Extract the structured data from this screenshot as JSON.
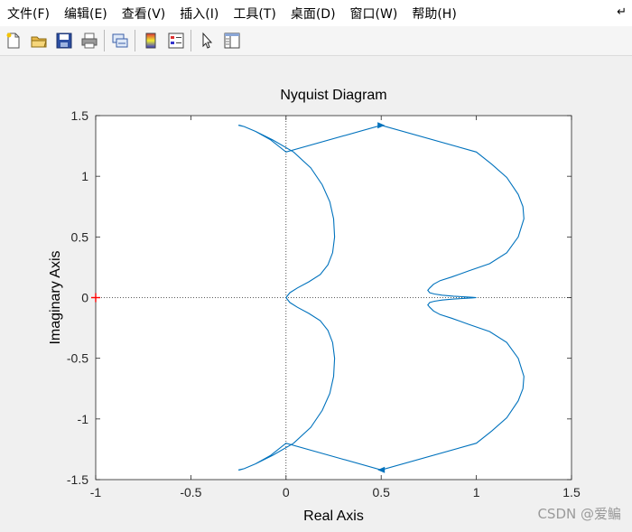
{
  "menu": {
    "items": [
      "文件(F)",
      "编辑(E)",
      "查看(V)",
      "插入(I)",
      "工具(T)",
      "桌面(D)",
      "窗口(W)",
      "帮助(H)"
    ],
    "corner_icon": "dock-arrow-icon"
  },
  "toolbar": {
    "buttons": [
      "new-figure-icon",
      "open-file-icon",
      "save-icon",
      "print-icon",
      "link-plot-icon",
      "colorbar-icon",
      "legend-icon",
      "pointer-icon",
      "plot-browser-icon"
    ]
  },
  "watermark": "CSDN @爱鳊",
  "chart_data": {
    "type": "line",
    "title": "Nyquist Diagram",
    "xlabel": "Real Axis",
    "ylabel": "Imaginary Axis",
    "xlim": [
      -1,
      1.5
    ],
    "ylim": [
      -1.5,
      1.5
    ],
    "xticks": [
      "-1",
      "-0.5",
      "0",
      "0.5",
      "1",
      "1.5"
    ],
    "yticks": [
      "-1.5",
      "-1",
      "-0.5",
      "0",
      "0.5",
      "1",
      "1.5"
    ],
    "grid": false,
    "line_color": "#0072bd",
    "critical_point": {
      "x": -1,
      "y": 0,
      "marker": "+",
      "color": "#ff0000"
    },
    "series": [
      {
        "x": [
          0,
          0.02,
          0.06,
          0.12,
          0.18,
          0.22,
          0.245,
          0.255,
          0.25,
          0.23,
          0.19,
          0.13,
          0.04,
          -0.07,
          -0.16,
          -0.22,
          -0.25,
          -0.245,
          -0.22,
          -0.16,
          -0.08,
          0,
          0.5,
          1,
          1.08,
          1.16,
          1.22,
          1.245,
          1.25,
          1.22,
          1.16,
          1.07,
          0.96,
          0.87,
          0.81,
          0.775,
          0.755,
          0.745,
          0.755,
          0.78,
          0.82,
          0.88,
          0.94,
          0.98,
          1
        ],
        "y": [
          0,
          -0.04,
          -0.08,
          -0.13,
          -0.19,
          -0.27,
          -0.37,
          -0.5,
          -0.65,
          -0.79,
          -0.93,
          -1.07,
          -1.2,
          -1.3,
          -1.37,
          -1.41,
          -1.42,
          -1.42,
          -1.41,
          -1.37,
          -1.3,
          -1.2,
          -1.42,
          -1.2,
          -1.1,
          -0.99,
          -0.85,
          -0.75,
          -0.65,
          -0.5,
          -0.37,
          -0.28,
          -0.22,
          -0.17,
          -0.14,
          -0.11,
          -0.08,
          -0.06,
          -0.04,
          -0.03,
          -0.02,
          -0.012,
          -0.006,
          -0.002,
          0
        ]
      }
    ],
    "direction_arrows": [
      {
        "x": 0.5,
        "y": 1.42,
        "dir": "right"
      },
      {
        "x": 0.5,
        "y": -1.42,
        "dir": "left"
      }
    ]
  }
}
